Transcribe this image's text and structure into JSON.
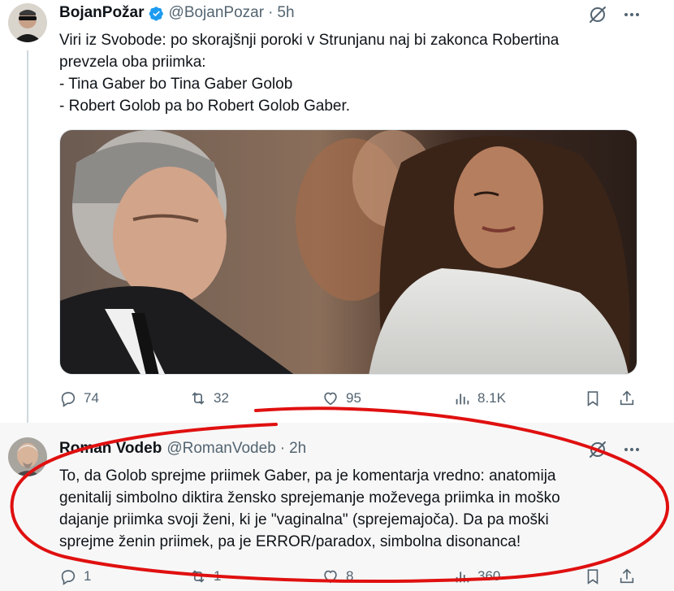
{
  "tweets": [
    {
      "name": "BojanPožar",
      "handle": "@BojanPozar",
      "dot": "·",
      "time": "5h",
      "text": "Viri iz Svobode: po skorajšnji poroki v Strunjanu naj bi zakonca Robertina\nprevzela oba priimka:\n- Tina Gaber bo Tina Gaber Golob\n- Robert Golob pa bo Robert Golob Gaber.",
      "stats": {
        "replies": "74",
        "reposts": "32",
        "likes": "95",
        "views": "8.1K"
      }
    },
    {
      "name": "Roman Vodeb",
      "handle": "@RomanVodeb",
      "dot": "·",
      "time": "2h",
      "text": "To, da Golob sprejme priimek Gaber, pa je komentarja vredno: anatomija\ngenitalij simbolno diktira žensko sprejemanje moževega priimka in moško\ndajanje priimka svoji ženi, ki je \"vaginalna\" (sprejemajoča). Da pa moški\nsprejme ženin priimek, pa je ERROR/paradox, simbolna disonanca!",
      "stats": {
        "replies": "1",
        "reposts": "1",
        "likes": "8",
        "views": "360"
      }
    }
  ],
  "icons": {
    "verified": "verified-badge-icon",
    "grok": "grok-icon",
    "more": "more-icon",
    "reply": "reply-icon",
    "repost": "repost-icon",
    "like": "like-icon",
    "views": "views-icon",
    "bookmark": "bookmark-icon",
    "share": "share-icon"
  },
  "colors": {
    "accent": "#1d9bf0",
    "text": "#0f1419",
    "secondary": "#536471",
    "annotation": "#e01010"
  }
}
